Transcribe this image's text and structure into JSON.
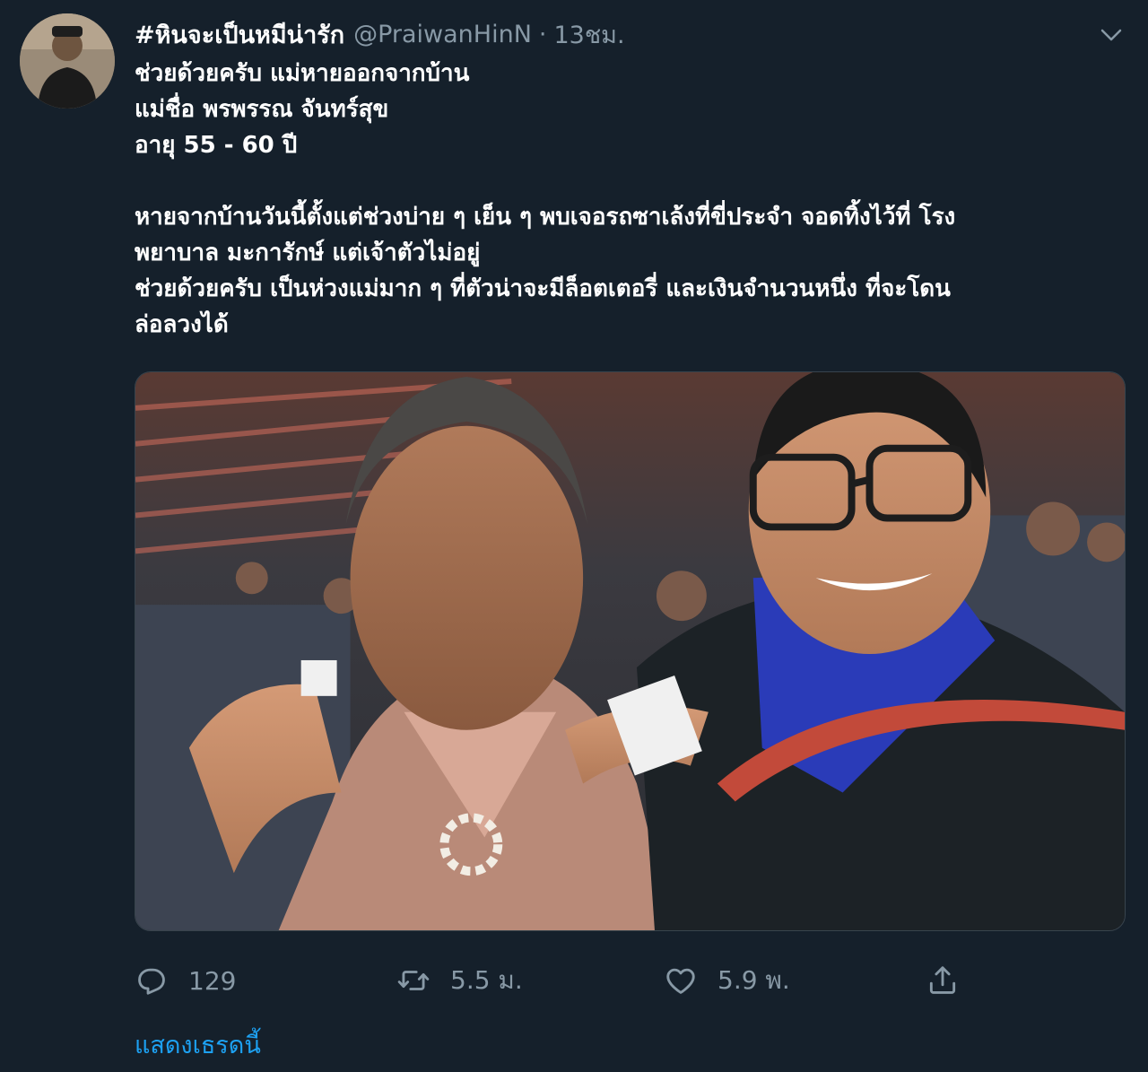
{
  "tweet": {
    "display_name": "#หินจะเป็นหมีน่ารัก",
    "handle": "@PraiwanHinN",
    "separator": "·",
    "time": "13ชม.",
    "text_lines": [
      "ช่วยด้วยครับ แม่หายออกจากบ้าน",
      "แม่ชื่อ พรพรรณ จันทร์สุข",
      "อายุ 55 - 60 ปี",
      "",
      "หายจากบ้านวันนี้ตั้งแต่ช่วงบ่าย ๆ เย็น ๆ พบเจอรถซาเล้งที่ขี่ประจำ จอดทิ้งไว้ที่ โรง",
      "พยาบาล มะการักษ์ แต่เจ้าตัวไม่อยู่",
      "ช่วยด้วยครับ เป็นห่วงแม่มาก ๆ ที่ตัวน่าจะมีล็อตเตอรี่ และเงินจำนวนหนึ่ง ที่จะโดน",
      "ล่อลวงได้"
    ],
    "media_icon": "photo",
    "avatar_icon": "user-avatar",
    "caret_icon": "chevron-down-icon"
  },
  "actions": {
    "reply": {
      "icon": "reply-icon",
      "count": "129"
    },
    "retweet": {
      "icon": "retweet-icon",
      "count": "5.5 ม."
    },
    "like": {
      "icon": "heart-icon",
      "count": "5.9 พ."
    },
    "share": {
      "icon": "share-icon"
    }
  },
  "show_thread": "แสดงเธรดนี้",
  "colors": {
    "background": "#15202b",
    "text": "#ffffff",
    "secondary": "#8899a6",
    "link": "#1da1f2",
    "border": "#38444d"
  }
}
